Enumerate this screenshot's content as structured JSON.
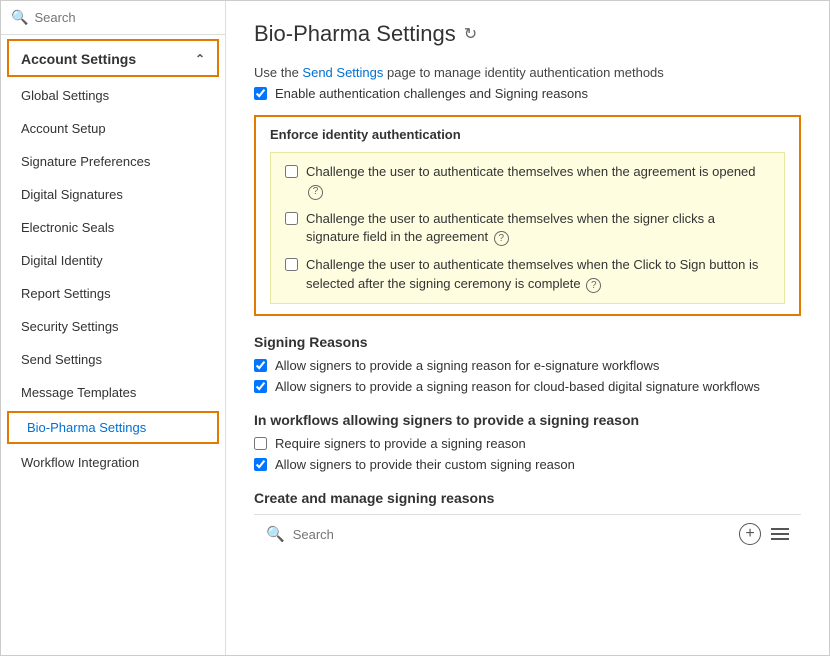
{
  "window": {
    "title": "Bio-Pharma Settings"
  },
  "sidebar": {
    "search_placeholder": "Search",
    "account_settings_label": "Account Settings",
    "nav_items": [
      {
        "id": "global-settings",
        "label": "Global Settings",
        "active": false
      },
      {
        "id": "account-setup",
        "label": "Account Setup",
        "active": false
      },
      {
        "id": "signature-preferences",
        "label": "Signature Preferences",
        "active": false
      },
      {
        "id": "digital-signatures",
        "label": "Digital Signatures",
        "active": false
      },
      {
        "id": "electronic-seals",
        "label": "Electronic Seals",
        "active": false
      },
      {
        "id": "digital-identity",
        "label": "Digital Identity",
        "active": false
      },
      {
        "id": "report-settings",
        "label": "Report Settings",
        "active": false
      },
      {
        "id": "security-settings",
        "label": "Security Settings",
        "active": false
      },
      {
        "id": "send-settings",
        "label": "Send Settings",
        "active": false
      },
      {
        "id": "message-templates",
        "label": "Message Templates",
        "active": false
      },
      {
        "id": "bio-pharma-settings",
        "label": "Bio-Pharma Settings",
        "active": true
      },
      {
        "id": "workflow-integration",
        "label": "Workflow Integration",
        "active": false
      }
    ]
  },
  "main": {
    "title": "Bio-Pharma Settings",
    "intro": {
      "text_before_link": "Use the ",
      "link_text": "Send Settings",
      "text_after_link": " page to manage identity authentication methods"
    },
    "enable_auth_label": "Enable authentication challenges and Signing reasons",
    "enforce_box": {
      "title": "Enforce identity authentication",
      "items": [
        {
          "id": "challenge-open",
          "text": "Challenge the user to authenticate themselves when the agreement is opened",
          "checked": false,
          "has_help": true
        },
        {
          "id": "challenge-field",
          "text": "Challenge the user to authenticate themselves when the signer clicks a signature field in the agreement",
          "checked": false,
          "has_help": true
        },
        {
          "id": "challenge-click-sign",
          "text": "Challenge the user to authenticate themselves when the Click to Sign button is selected after the signing ceremony is complete",
          "checked": false,
          "has_help": true
        }
      ]
    },
    "signing_reasons": {
      "title": "Signing Reasons",
      "items": [
        {
          "id": "signing-reason-esig",
          "text": "Allow signers to provide a signing reason for e-signature workflows",
          "checked": true
        },
        {
          "id": "signing-reason-cloud",
          "text": "Allow signers to provide a signing reason for cloud-based digital signature workflows",
          "checked": true
        }
      ]
    },
    "workflows_section": {
      "title": "In workflows allowing signers to provide a signing reason",
      "items": [
        {
          "id": "require-signing-reason",
          "text": "Require signers to provide a signing reason",
          "checked": false
        },
        {
          "id": "allow-custom-reason",
          "text": "Allow signers to provide their custom signing reason",
          "checked": true
        }
      ]
    },
    "create_manage": {
      "title": "Create and manage signing reasons"
    },
    "bottom_search_placeholder": "Search"
  }
}
